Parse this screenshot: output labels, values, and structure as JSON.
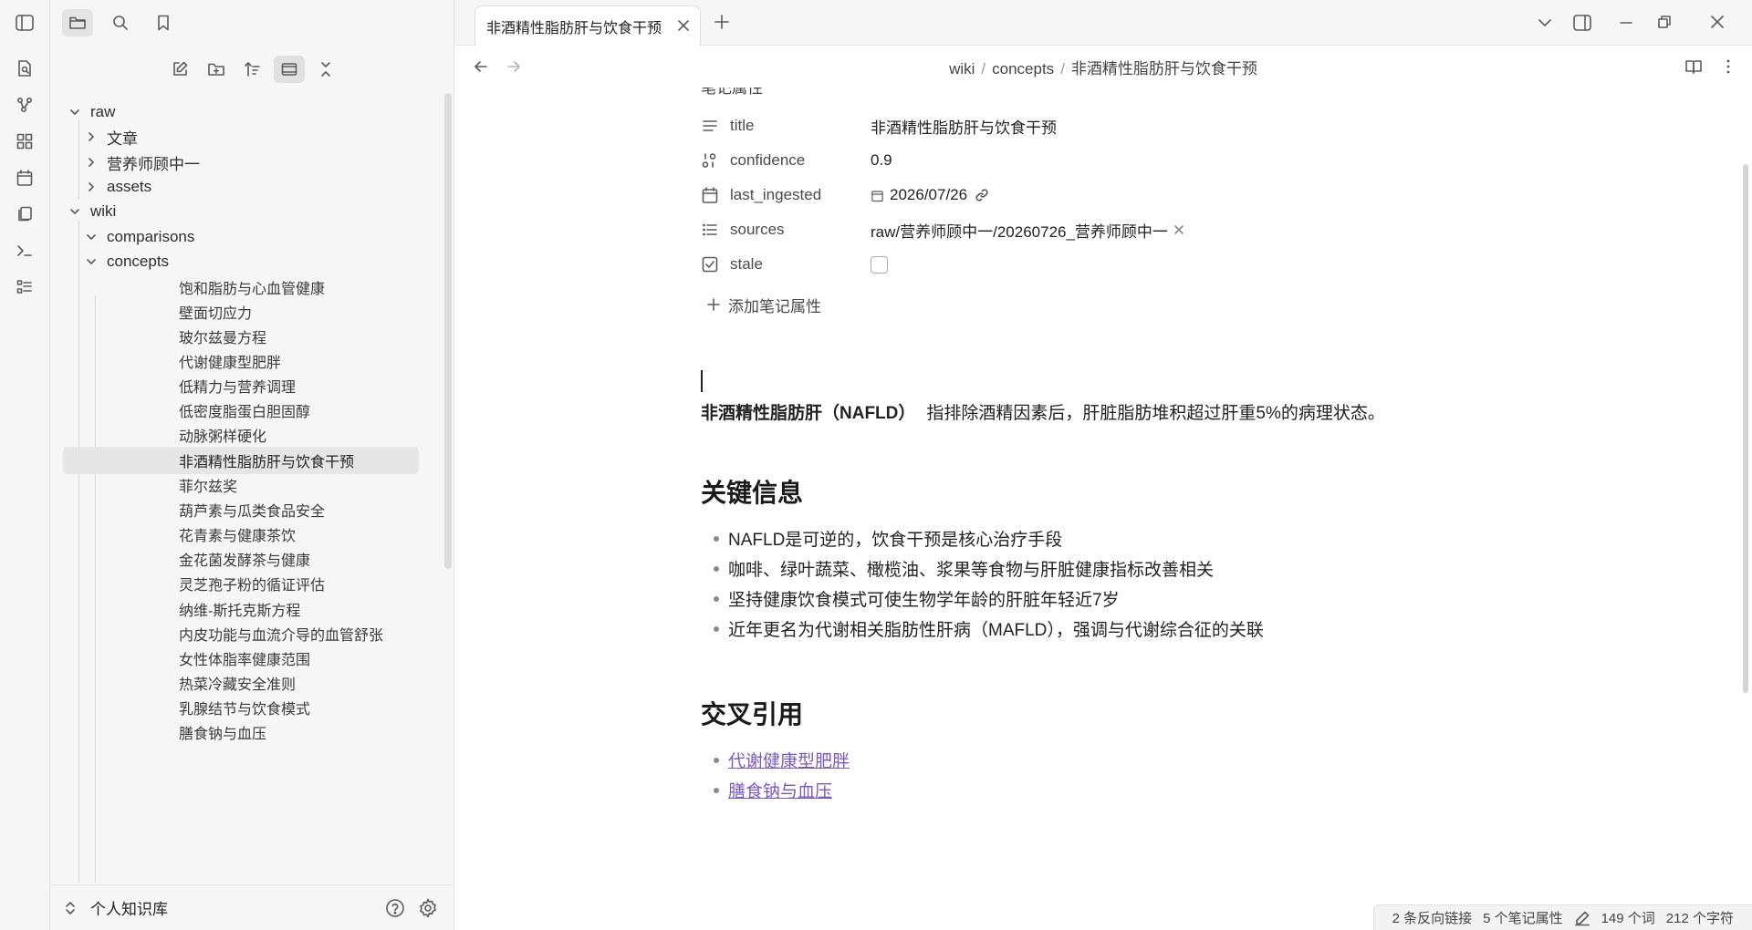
{
  "tab": {
    "title": "非酒精性脂肪肝与饮食干预"
  },
  "breadcrumb": [
    "wiki",
    "concepts",
    "非酒精性脂肪肝与饮食干预"
  ],
  "tree": {
    "raw": {
      "label": "raw",
      "children": [
        "文章",
        "营养师顾中一",
        "assets"
      ]
    },
    "wiki": {
      "label": "wiki",
      "comparisons": "comparisons",
      "concepts": "concepts"
    },
    "concept_items": [
      "饱和脂肪与心血管健康",
      "壁面切应力",
      "玻尔兹曼方程",
      "代谢健康型肥胖",
      "低精力与营养调理",
      "低密度脂蛋白胆固醇",
      "动脉粥样硬化",
      "非酒精性脂肪肝与饮食干预",
      "菲尔兹奖",
      "葫芦素与瓜类食品安全",
      "花青素与健康茶饮",
      "金花菌发酵茶与健康",
      "灵芝孢子粉的循证评估",
      "纳维-斯托克斯方程",
      "内皮功能与血流介导的血管舒张",
      "女性体脂率健康范围",
      "热菜冷藏安全准则",
      "乳腺结节与饮食模式",
      "膳食钠与血压"
    ],
    "active_index": 7
  },
  "vault": {
    "name": "个人知识库"
  },
  "properties": {
    "header": "笔记属性",
    "items": [
      {
        "key": "title",
        "value": "非酒精性脂肪肝与饮食干预",
        "icon": "text-icon"
      },
      {
        "key": "confidence",
        "value": "0.9",
        "icon": "number-icon"
      },
      {
        "key": "last_ingested",
        "value": "2026/07/26",
        "icon": "calendar-icon"
      },
      {
        "key": "sources",
        "value": "raw/营养师顾中一/20260726_营养师顾中一",
        "icon": "list-icon"
      },
      {
        "key": "stale",
        "value": "",
        "icon": "checkbox-icon"
      }
    ],
    "add_label": "添加笔记属性"
  },
  "body": {
    "intro_bold": "非酒精性脂肪肝（NAFLD）",
    "intro_rest": "指排除酒精因素后，肝脏脂肪堆积超过肝重5%的病理状态。",
    "section1": "关键信息",
    "bullets": [
      "NAFLD是可逆的，饮食干预是核心治疗手段",
      "咖啡、绿叶蔬菜、橄榄油、浆果等食物与肝脏健康指标改善相关",
      "坚持健康饮食模式可使生物学年龄的肝脏年轻近7岁",
      "近年更名为代谢相关脂肪性肝病（MAFLD），强调与代谢综合征的关联"
    ],
    "section2": "交叉引用",
    "links": [
      "代谢健康型肥胖",
      "膳食钠与血压"
    ]
  },
  "status": {
    "backlinks": "2 条反向链接",
    "props": "5 个笔记属性",
    "words": "149 个词",
    "chars": "212 个字符"
  },
  "colors": {
    "accent_link": "#7b58c8",
    "sidebar_bg": "#f6f6f6"
  }
}
